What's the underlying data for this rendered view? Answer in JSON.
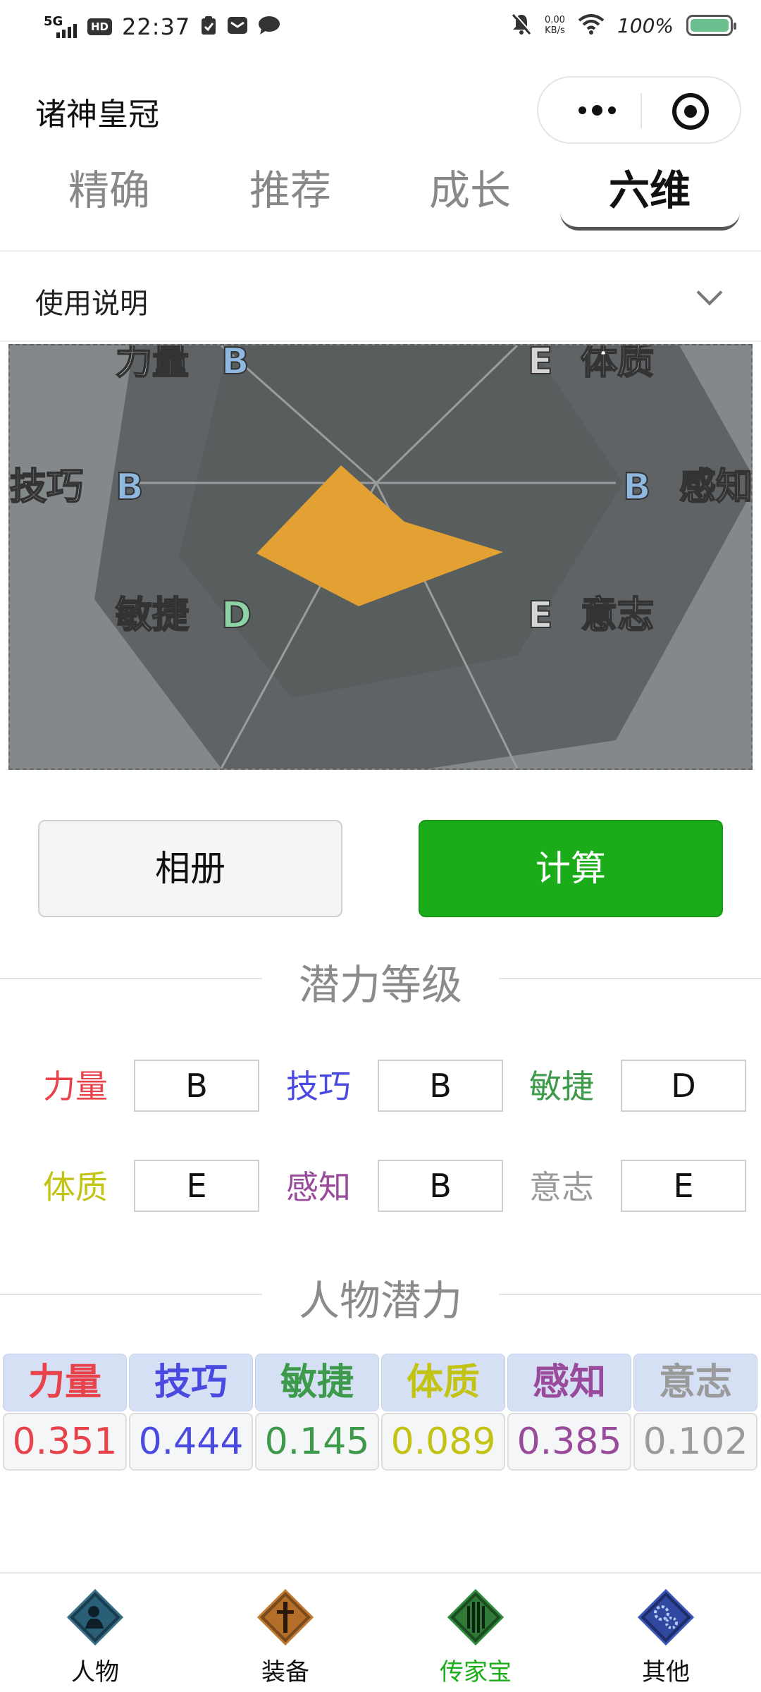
{
  "status_bar": {
    "network": "5G",
    "hd": "HD",
    "time": "22:37",
    "speed_value": "0.00",
    "speed_unit": "KB/s",
    "battery_text": "100%",
    "battery_level": 1.0
  },
  "header": {
    "title": "诸神皇冠"
  },
  "tabs": [
    {
      "label": "精确",
      "active": false
    },
    {
      "label": "推荐",
      "active": false
    },
    {
      "label": "成长",
      "active": false
    },
    {
      "label": "六维",
      "active": true
    }
  ],
  "instructions": {
    "label": "使用说明"
  },
  "preview": {
    "labels": {
      "strength": "力量",
      "strength_grade": "B",
      "constitution": "体质",
      "constitution_grade": "E",
      "skill": "技巧",
      "skill_grade": "B",
      "perception": "感知",
      "perception_grade": "B",
      "agility": "敏捷",
      "agility_grade": "D",
      "will": "意志",
      "will_grade": "E"
    },
    "colors": {
      "background": "#83888a",
      "hexagon": "#5f6365",
      "shape": "#e3a033",
      "grade_b": "#8fb8e0",
      "grade_d": "#8ed3a4",
      "grade_e": "#d5d5d5"
    }
  },
  "buttons": {
    "album": "相册",
    "calculate": "计算"
  },
  "sections": {
    "grades_title": "潜力等级",
    "potential_title": "人物潜力"
  },
  "grades": [
    {
      "label": "力量",
      "value": "B",
      "color": "#e8434b"
    },
    {
      "label": "技巧",
      "value": "B",
      "color": "#4a4ae0"
    },
    {
      "label": "敏捷",
      "value": "D",
      "color": "#3d9a4a"
    },
    {
      "label": "体质",
      "value": "E",
      "color": "#c3c314"
    },
    {
      "label": "感知",
      "value": "B",
      "color": "#9a4a9a"
    },
    {
      "label": "意志",
      "value": "E",
      "color": "#9a9a9a"
    }
  ],
  "potential": [
    {
      "label": "力量",
      "value": "0.351",
      "color": "#e8434b"
    },
    {
      "label": "技巧",
      "value": "0.444",
      "color": "#4a4ae0"
    },
    {
      "label": "敏捷",
      "value": "0.145",
      "color": "#3d9a4a"
    },
    {
      "label": "体质",
      "value": "0.089",
      "color": "#c3c314"
    },
    {
      "label": "感知",
      "value": "0.385",
      "color": "#9a4a9a"
    },
    {
      "label": "意志",
      "value": "0.102",
      "color": "#9a9a9a"
    }
  ],
  "nav": [
    {
      "label": "人物",
      "icon": "character-icon",
      "active": false
    },
    {
      "label": "装备",
      "icon": "equipment-icon",
      "active": false
    },
    {
      "label": "传家宝",
      "icon": "heirloom-icon",
      "active": true
    },
    {
      "label": "其他",
      "icon": "other-gears-icon",
      "active": false
    }
  ]
}
